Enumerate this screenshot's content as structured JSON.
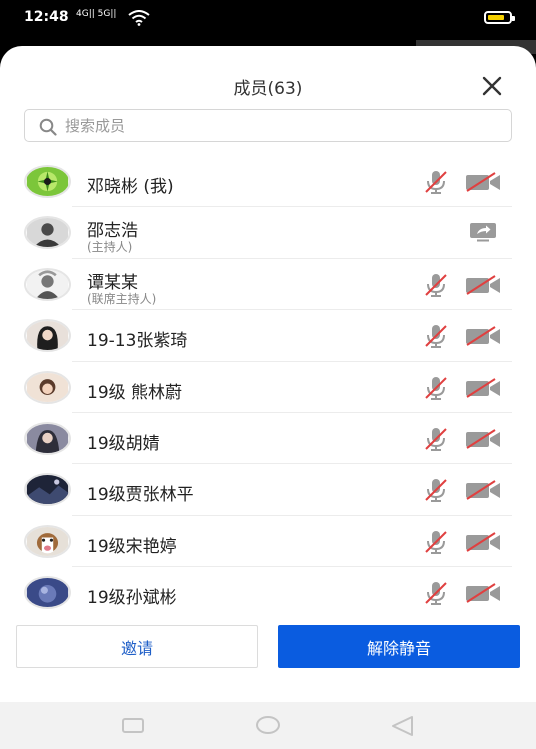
{
  "status_bar": {
    "time": "12:48",
    "signal_text": "4G|| 5G||"
  },
  "dialog": {
    "title": "成员(63)",
    "close_icon": "close-icon"
  },
  "search": {
    "placeholder": "搜索成员",
    "value": ""
  },
  "members": [
    {
      "name": "邓晓彬 (我)",
      "role": "",
      "mic": "muted",
      "camera": "off",
      "avatar_color": "#8fd14a"
    },
    {
      "name": "邵志浩",
      "role": "(主持人)",
      "mic": "",
      "camera": "",
      "screen_share": true,
      "avatar_color": "#5a5a5a"
    },
    {
      "name": "谭某某",
      "role": "(联席主持人)",
      "mic": "muted",
      "camera": "off",
      "avatar_color": "#9a9a9a"
    },
    {
      "name": "19-13张紫琦",
      "role": "",
      "mic": "muted",
      "camera": "off",
      "avatar_color": "#3a3a3a"
    },
    {
      "name": "19级 熊林蔚",
      "role": "",
      "mic": "muted",
      "camera": "off",
      "avatar_color": "#c99a7a"
    },
    {
      "name": "19级胡婧",
      "role": "",
      "mic": "muted",
      "camera": "off",
      "avatar_color": "#6f6f88"
    },
    {
      "name": "19级贾张林平",
      "role": "",
      "mic": "muted",
      "camera": "off",
      "avatar_color": "#2c3550"
    },
    {
      "name": "19级宋艳婷",
      "role": "",
      "mic": "muted",
      "camera": "off",
      "avatar_color": "#b07a4a"
    },
    {
      "name": "19级孙斌彬",
      "role": "",
      "mic": "muted",
      "camera": "off",
      "avatar_color": "#4a5a9a"
    }
  ],
  "buttons": {
    "invite": "邀请",
    "unmute": "解除静音"
  },
  "colors": {
    "accent": "#0a5ce0",
    "muted_slash": "#e04040",
    "icon_gray": "#8a8a8a"
  }
}
